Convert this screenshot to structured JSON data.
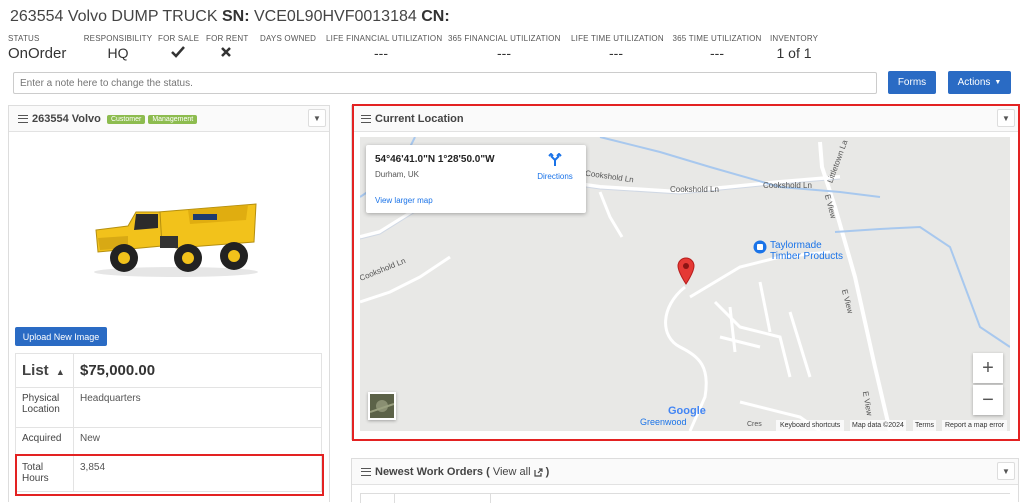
{
  "header": {
    "id_make": "263554 Volvo DUMP TRUCK",
    "sn_label": "SN:",
    "sn_value": "VCE0L90HVF0013184",
    "cn_label": "CN:"
  },
  "stats": [
    {
      "label": "STATUS",
      "value": "OnOrder"
    },
    {
      "label": "RESPONSIBILITY",
      "value": "HQ"
    },
    {
      "label": "FOR SALE",
      "icon": "check-icon"
    },
    {
      "label": "FOR RENT",
      "icon": "x-icon"
    },
    {
      "label": "DAYS OWNED",
      "value": ""
    },
    {
      "label": "LIFE FINANCIAL UTILIZATION",
      "value": "---"
    },
    {
      "label": "365 FINANCIAL UTILIZATION",
      "value": "---"
    },
    {
      "label": "LIFE TIME UTILIZATION",
      "value": "---"
    },
    {
      "label": "365 TIME UTILIZATION",
      "value": "---"
    },
    {
      "label": "INVENTORY",
      "value": "1 of 1"
    }
  ],
  "note": {
    "placeholder": "Enter a note here to change the status."
  },
  "buttons": {
    "forms": "Forms",
    "actions": "Actions"
  },
  "equipment_panel": {
    "title": "263554 Volvo",
    "badges": [
      "Customer",
      "Management"
    ],
    "upload_label": "Upload New Image",
    "price_label": "List",
    "price": "$75,000.00",
    "rows": [
      {
        "key": "Physical Location",
        "value": "Headquarters"
      },
      {
        "key": "Acquired",
        "value": "New"
      },
      {
        "key": "Total Hours",
        "value": "3,854"
      }
    ]
  },
  "location_panel": {
    "title": "Current Location",
    "coords": "54°46'41.0\"N 1°28'50.0\"W",
    "place": "Durham, UK",
    "directions": "Directions",
    "larger_map": "View larger map",
    "roads": [
      "Cookshold Ln",
      "Cookshold Ln",
      "Cookshold Ln",
      "Cookshold Ln",
      "Littletown La",
      "E View",
      "E View",
      "E View"
    ],
    "poi": "Taylormade Timber Products",
    "poi_line1": "Taylormade",
    "poi_line2": "Timber Products",
    "area": "Greenwood",
    "cres": "Cres",
    "google": "Google",
    "footer": [
      "Keyboard shortcuts",
      "Map data ©2024",
      "Terms",
      "Report a map error"
    ],
    "accent_color": "#1a73e8",
    "pin_color": "#e53935"
  },
  "work_orders_panel": {
    "title": "Newest Work Orders",
    "view_all": "View all"
  }
}
